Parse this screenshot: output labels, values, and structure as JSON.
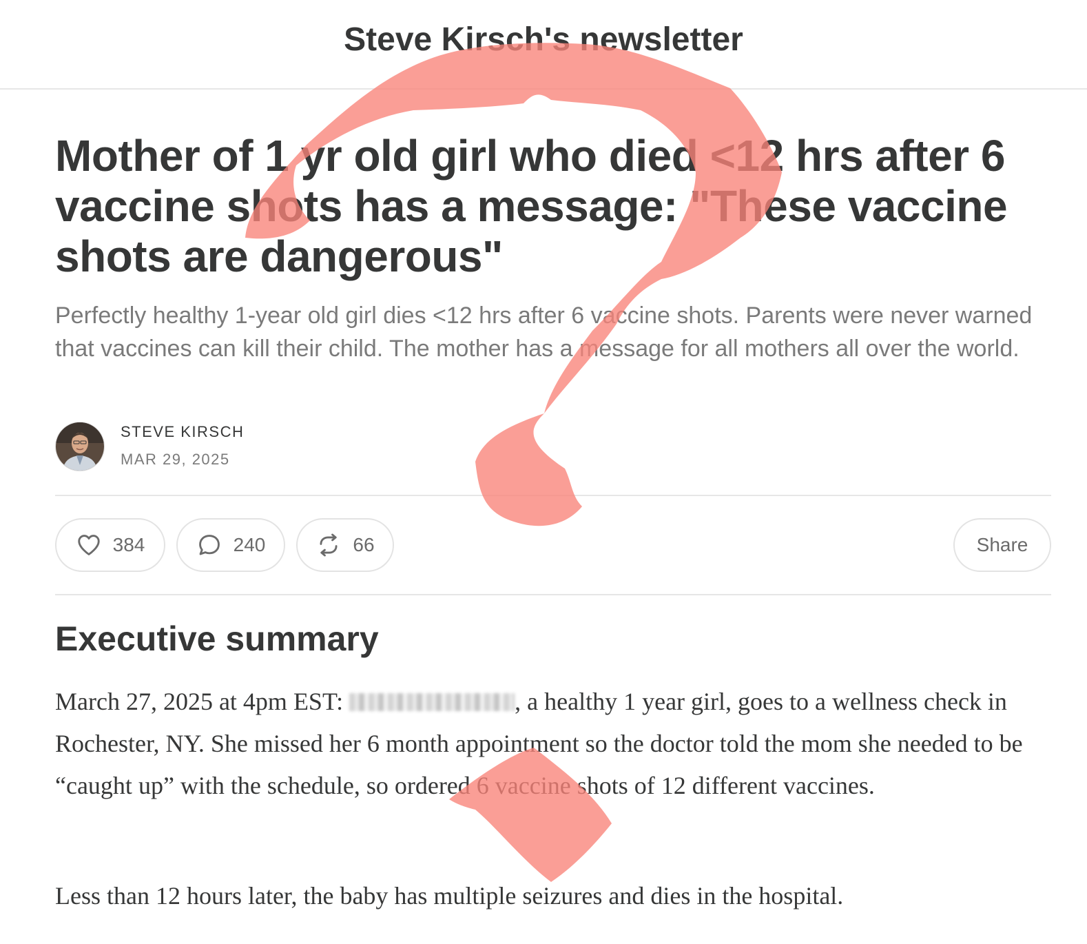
{
  "header": {
    "publication_title": "Steve Kirsch's newsletter"
  },
  "post": {
    "title": "Mother of 1 yr old girl who died <12 hrs after 6 vaccine shots has a message: \"These vaccine shots are dangerous\"",
    "subtitle": "Perfectly healthy 1-year old girl dies <12 hrs after 6 vaccine shots. Parents were never warned that vaccines can kill their child. The mother has a message for all mothers all over the world.",
    "author": "STEVE KIRSCH",
    "date": "MAR 29, 2025"
  },
  "actions": {
    "likes": "384",
    "comments": "240",
    "restacks": "66",
    "share_label": "Share"
  },
  "content": {
    "section_heading": "Executive summary",
    "para1_before": "March 27, 2025 at 4pm EST: ",
    "para1_after": ", a healthy 1 year girl, goes to a wellness check in Rochester, NY. She missed her 6 month appointment so the doctor told the mom she needed to be “caught up” with the schedule, so ordered 6 vaccine shots of 12 different vaccines.",
    "para2": "Less than 12 hours later, the baby has multiple seizures and dies in the hospital."
  },
  "colors": {
    "text": "#363737",
    "muted": "#7a7a7a",
    "divider": "#e6e6e6",
    "annotation": "#f88379"
  },
  "icons": {
    "likes": "heart-icon",
    "comments": "comment-bubble-icon",
    "restacks": "restack-icon"
  }
}
